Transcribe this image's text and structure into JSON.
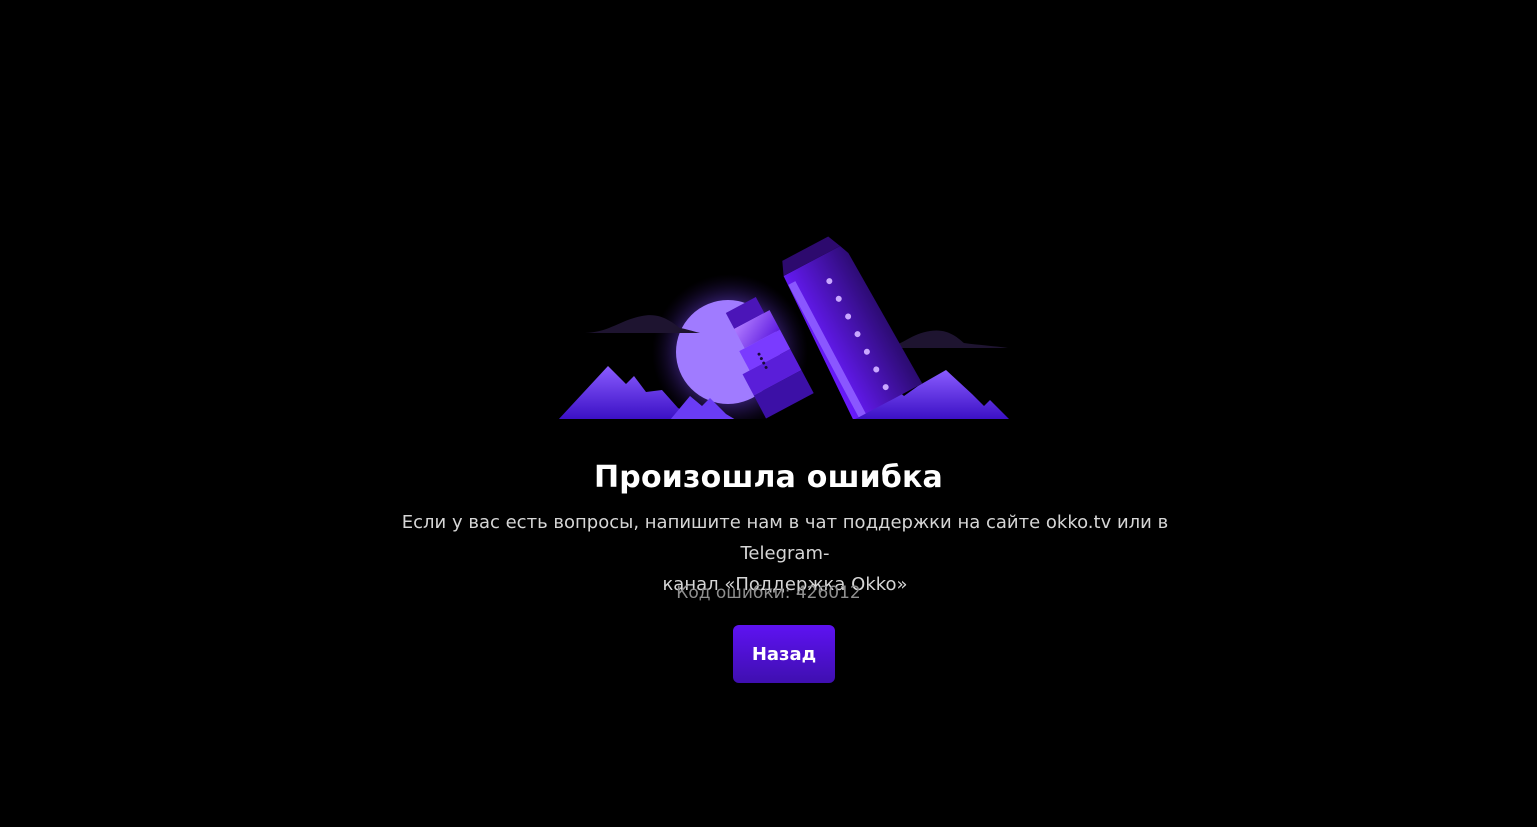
{
  "error_page": {
    "illustration_icon": "sinking-ship-illustration",
    "title": "Произошла ошибка",
    "message_line1": "Если у вас есть вопросы, напишите нам в чат поддержки на сайте okko.tv или в Telegram-",
    "message_line2": "канал «Поддержка Okko»",
    "error_code": "Код ошибки: 426012",
    "back_button_label": "Назад"
  },
  "colors": {
    "background": "#000000",
    "accent": "#5e12f2",
    "title": "#ffffff",
    "message": "#d6d6d6",
    "error_code": "#8f8f8f"
  }
}
